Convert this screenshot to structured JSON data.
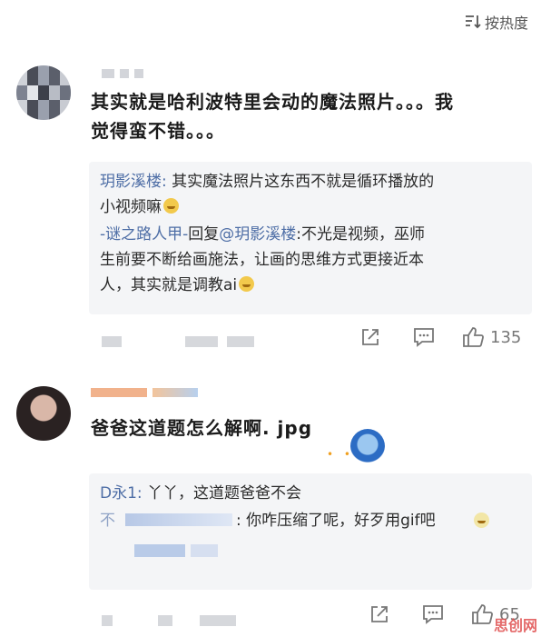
{
  "sort_label": "按热度",
  "comments": [
    {
      "text_line1": "其实就是哈利波特里会动的魔法照片。。。我",
      "text_line2": "觉得蛮不错。。。",
      "replies": [
        {
          "name": "玥影溪楼:",
          "text_l1": " 其实魔法照片这东西不就是循环播放的",
          "text_l2": "小视频嘛"
        },
        {
          "name": "-谜之路人甲-",
          "mid": "回复",
          "mention": "@玥影溪楼",
          "text_l1": ":不光是视频，巫师",
          "text_l2": "生前要不断给画施法，让画的思维方式更接近本",
          "text_l3": "人，其实就是调教ai"
        }
      ],
      "like_count": "135"
    },
    {
      "text": "爸爸这道题怎么解啊. jpg",
      "replies": [
        {
          "name": "D永1:",
          "text": " 丫丫，这道题爸爸不会"
        },
        {
          "name_blurred": "不",
          "text": ": 你咋压缩了呢，好歹用gif吧"
        }
      ],
      "like_count": "65"
    }
  ],
  "watermark": "思创网",
  "icons": [
    "sort-icon",
    "share-icon",
    "comment-icon",
    "like-icon",
    "emoji-icon"
  ]
}
